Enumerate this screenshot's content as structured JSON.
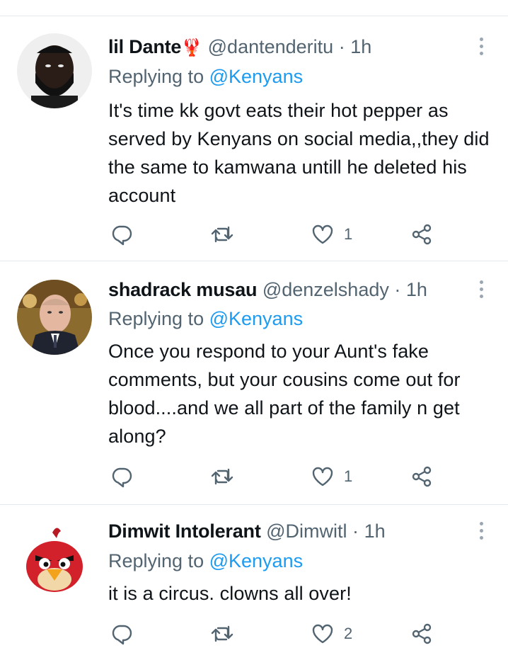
{
  "tweets": [
    {
      "name": "lil Dante",
      "name_emoji": "🦞",
      "handle": "@dantenderitu",
      "separator": "·",
      "time": "1h",
      "replying_prefix": "Replying to",
      "replying_to": "@Kenyans",
      "text": "It's time kk govt eats their hot pepper as served by Kenyans on social media,,they did the same to kamwana untill he deleted his account",
      "like_count": "1",
      "avatar_colors": {
        "bg": "#f2f2f2",
        "skin": "#2a1d17"
      }
    },
    {
      "name": "shadrack musau",
      "handle": "@denzelshady",
      "separator": "·",
      "time": "1h",
      "replying_prefix": "Replying to",
      "replying_to": "@Kenyans",
      "text": "Once you respond to your Aunt's fake comments, but your cousins come out for blood....and we all part of the family n get along?",
      "like_count": "1",
      "avatar_colors": {
        "bg": "#8c6b2e",
        "skin": "#e4b7a1",
        "suit": "#1f2430"
      }
    },
    {
      "name": "Dimwit Intolerant",
      "handle": "@Dimwitl",
      "separator": "·",
      "time": "1h",
      "replying_prefix": "Replying to",
      "replying_to": "@Kenyans",
      "text": "it is a circus. clowns all over!",
      "like_count": "2",
      "avatar_colors": {
        "bg": "#ffffff",
        "bird": "#d3212c",
        "belly": "#f2d7a8",
        "beak": "#f2a31b"
      }
    }
  ],
  "icons": {
    "reply": "reply-icon",
    "retweet": "retweet-icon",
    "like": "heart-icon",
    "share": "share-icon",
    "more": "more-options-icon"
  },
  "colors": {
    "text": "#0f1419",
    "secondary": "#536471",
    "link": "#1d9bf0",
    "divider": "#e6e9ec"
  }
}
